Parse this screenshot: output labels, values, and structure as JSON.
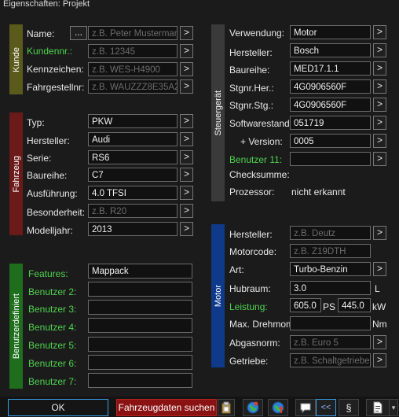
{
  "window": {
    "title": "Eigenschaften: Projekt"
  },
  "colors": {
    "kunde": "#5a5a1c",
    "fahrzeug": "#6b1a1a",
    "benutzer": "#1e6e1e",
    "steuergeraet": "#3a3a3a",
    "motor": "#0f3a8a",
    "user_green": "#4fd24f"
  },
  "kunde": {
    "section": "Kunde",
    "name_label": "Name:",
    "name_browse": "...",
    "name_placeholder": "z.B. Peter Mustermann",
    "kundennr_label": "Kundennr.:",
    "kundennr_placeholder": "z.B. 12345",
    "kennzeichen_label": "Kennzeichen:",
    "kennzeichen_placeholder": "z.B. WES-H4900",
    "fahrgestell_label": "Fahrgestellnr:",
    "fahrgestell_placeholder": "z.B. WAUZZZ8E35A235"
  },
  "fahrzeug": {
    "section": "Fahrzeug",
    "typ_label": "Typ:",
    "typ_value": "PKW",
    "hersteller_label": "Hersteller:",
    "hersteller_value": "Audi",
    "serie_label": "Serie:",
    "serie_value": "RS6",
    "baureihe_label": "Baureihe:",
    "baureihe_value": "C7",
    "ausfuehrung_label": "Ausführung:",
    "ausfuehrung_value": "4.0 TFSI",
    "besonderheit_label": "Besonderheit:",
    "besonderheit_placeholder": "z.B. R20",
    "modelljahr_label": "Modelljahr:",
    "modelljahr_value": "2013"
  },
  "benutzerdefiniert": {
    "section": "Benutzerdefiniert",
    "features_label": "Features:",
    "features_value": "Mappack",
    "b2": "Benutzer 2:",
    "b3": "Benutzer 3:",
    "b4": "Benutzer 4:",
    "b5": "Benutzer 5:",
    "b6": "Benutzer 6:",
    "b7": "Benutzer 7:"
  },
  "steuergeraet": {
    "section": "Steuergerät",
    "verwendung_label": "Verwendung:",
    "verwendung_value": "Motor",
    "hersteller_label": "Hersteller:",
    "hersteller_value": "Bosch",
    "baureihe_label": "Baureihe:",
    "baureihe_value": "MED17.1.1",
    "stgnr_her_label": "Stgnr.Her.:",
    "stgnr_her_value": "4G0906560F",
    "stgnr_stg_label": "Stgnr.Stg.:",
    "stgnr_stg_value": "4G0906560F",
    "softwarestand_label": "Softwarestand:",
    "softwarestand_value": "051719",
    "version_label": "+ Version:",
    "version_value": "0005",
    "benutzer11_label": "Benutzer 11:",
    "checksumme_label": "Checksumme:",
    "prozessor_label": "Prozessor:",
    "prozessor_value": "nicht erkannt"
  },
  "motor": {
    "section": "Motor",
    "hersteller_label": "Hersteller:",
    "hersteller_placeholder": "z.B. Deutz",
    "motorcode_label": "Motorcode:",
    "motorcode_placeholder": "z.B. Z19DTH",
    "art_label": "Art:",
    "art_value": "Turbo-Benzin",
    "hubraum_label": "Hubraum:",
    "hubraum_value": "3.0",
    "hubraum_unit": "L",
    "leistung_label": "Leistung:",
    "leistung_ps": "605.0",
    "ps_unit": "PS",
    "leistung_kw": "445.0",
    "kw_unit": "kW",
    "drehmom_label": "Max. Drehmom.",
    "drehmom_unit": "Nm",
    "abgasnorm_label": "Abgasnorm:",
    "abgasnorm_placeholder": "z.B. Euro 5",
    "getriebe_label": "Getriebe:",
    "getriebe_placeholder": "z.B. Schaltgetriebe"
  },
  "footer": {
    "ok": "OK",
    "search": "Fahrzeugdaten suchen",
    "back": "<<",
    "paragraph": "§",
    "more": "▾"
  },
  "arrow": ">"
}
